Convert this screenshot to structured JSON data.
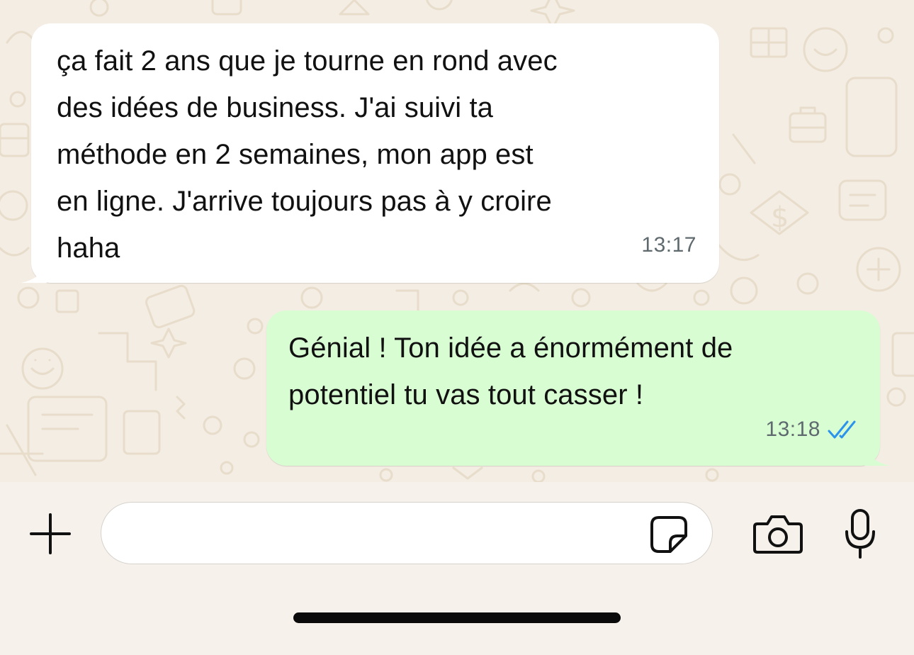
{
  "conversation": {
    "messages": [
      {
        "direction": "incoming",
        "text": "ça fait 2 ans que je tourne en rond avec\ndes idées de business. J'ai suivi ta\nméthode en 2 semaines, mon app est\nen ligne. J'arrive toujours pas à y croire\nhaha",
        "time": "13:17"
      },
      {
        "direction": "outgoing",
        "text": "Génial ! Ton idée a énormément de\npotentiel tu vas tout casser !",
        "time": "13:18",
        "status": "read",
        "status_icon": "double-check-icon",
        "status_color": "#2c93ec"
      }
    ]
  },
  "composer": {
    "input_value": "",
    "add_icon": "plus-icon",
    "sticker_icon": "sticker-icon",
    "camera_icon": "camera-icon",
    "mic_icon": "microphone-icon"
  },
  "theme": {
    "chat_background": "#f4ede3",
    "incoming_bubble": "#ffffff",
    "outgoing_bubble": "#d9fdd3"
  }
}
